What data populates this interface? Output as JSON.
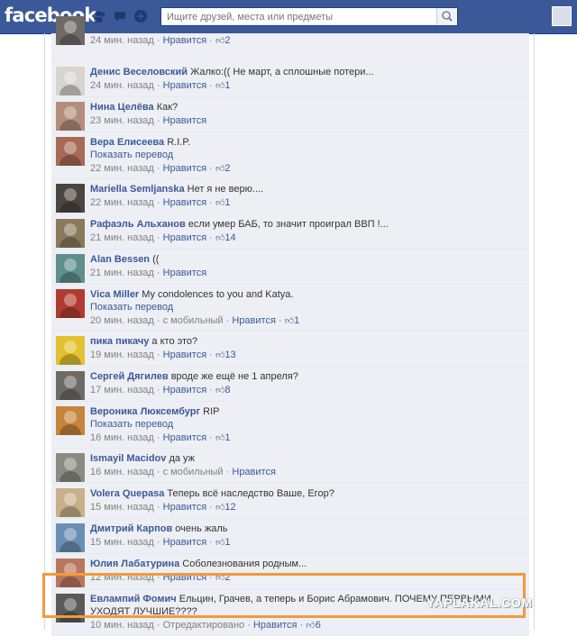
{
  "header": {
    "logo": "facebook",
    "search_placeholder": "Ищите друзей, места или предметы",
    "icons": [
      "friend-requests-icon",
      "messages-icon",
      "notifications-icon",
      "search-icon"
    ]
  },
  "colors": {
    "brand": "#3b5998",
    "comment_bg": "#edeff4",
    "highlight": "#f39a3a"
  },
  "comments": [
    {
      "name": "",
      "text": "",
      "translate": "",
      "meta": "24 мин. назад",
      "via": "",
      "like_label": "Нравится",
      "likes": "2",
      "avatar": "#6f6a66"
    },
    {
      "name": "Денис Веселовский",
      "text": "Жалко:(( Не март, а сплошные потери...",
      "translate": "",
      "meta": "24 мин. назад",
      "via": "",
      "like_label": "Нравится",
      "likes": "1",
      "avatar": "#d9d4cf"
    },
    {
      "name": "Нина Целёва",
      "text": "Как?",
      "translate": "",
      "meta": "23 мин. назад",
      "via": "",
      "like_label": "Нравится",
      "likes": "",
      "avatar": "#b48e7c"
    },
    {
      "name": "Вера Елисеева",
      "text": "R.I.P.",
      "translate": "Показать перевод",
      "meta": "22 мин. назад",
      "via": "",
      "like_label": "Нравится",
      "likes": "2",
      "avatar": "#a86a54"
    },
    {
      "name": "Mariella Semljanska",
      "text": "Нет я не верю....",
      "translate": "",
      "meta": "22 мин. назад",
      "via": "",
      "like_label": "Нравится",
      "likes": "1",
      "avatar": "#4a4540"
    },
    {
      "name": "Рафаэль Альханов",
      "text": "если умер БАБ, то значит проиграл ВВП !...",
      "translate": "",
      "meta": "21 мин. назад",
      "via": "",
      "like_label": "Нравится",
      "likes": "14",
      "avatar": "#8a7a5c"
    },
    {
      "name": "Alan Bessen",
      "text": "((",
      "translate": "",
      "meta": "21 мин. назад",
      "via": "",
      "like_label": "Нравится",
      "likes": "",
      "avatar": "#5f8f8a"
    },
    {
      "name": "Vica Miller",
      "text": "My condolences to you and Katya.",
      "translate": "Показать перевод",
      "meta": "20 мин. назад",
      "via": "с мобильный",
      "like_label": "Нравится",
      "likes": "1",
      "avatar": "#b23b2f"
    },
    {
      "name": "пика пикачу",
      "text": "а кто это?",
      "translate": "",
      "meta": "19 мин. назад",
      "via": "",
      "like_label": "Нравится",
      "likes": "13",
      "avatar": "#e2c22e"
    },
    {
      "name": "Сергей Дягилев",
      "text": "вроде же ещё не 1 апреля?",
      "translate": "",
      "meta": "17 мин. назад",
      "via": "",
      "like_label": "Нравится",
      "likes": "8",
      "avatar": "#6e6a66"
    },
    {
      "name": "Вероника Люксембург",
      "text": "RIP",
      "translate": "Показать перевод",
      "meta": "16 мин. назад",
      "via": "",
      "like_label": "Нравится",
      "likes": "1",
      "avatar": "#c5853b"
    },
    {
      "name": "Ismayil Macidov",
      "text": "да уж",
      "translate": "",
      "meta": "16 мин. назад",
      "via": "с мобильный",
      "like_label": "Нравится",
      "likes": "",
      "avatar": "#8b8b83"
    },
    {
      "name": "Volera Quepasa",
      "text": "Теперь всё наследство Ваше, Егор?",
      "translate": "",
      "meta": "15 мин. назад",
      "via": "",
      "like_label": "Нравится",
      "likes": "12",
      "avatar": "#c9b08a"
    },
    {
      "name": "Дмитрий Карпов",
      "text": "очень жаль",
      "translate": "",
      "meta": "15 мин. назад",
      "via": "",
      "like_label": "Нравится",
      "likes": "1",
      "avatar": "#6b8fb3"
    },
    {
      "name": "Юлия Лабатурина",
      "text": "Соболезнования родным...",
      "translate": "",
      "meta": "12 мин. назад",
      "via": "",
      "like_label": "Нравится",
      "likes": "2",
      "avatar": "#b9775f"
    },
    {
      "name": "Евлампий Фомич",
      "text": "Ельцин, Грачев, а теперь и Борис Абрамович. ПОЧЕМУ ПЕРВЫМИ УХОДЯТ ЛУЧШИЕ????",
      "translate": "",
      "meta": "10 мин. назад",
      "via": "Отредактировано",
      "like_label": "Нравится",
      "likes": "6",
      "avatar": "#5a5a5a"
    }
  ],
  "watermark": "YAPLAKAL.COM"
}
